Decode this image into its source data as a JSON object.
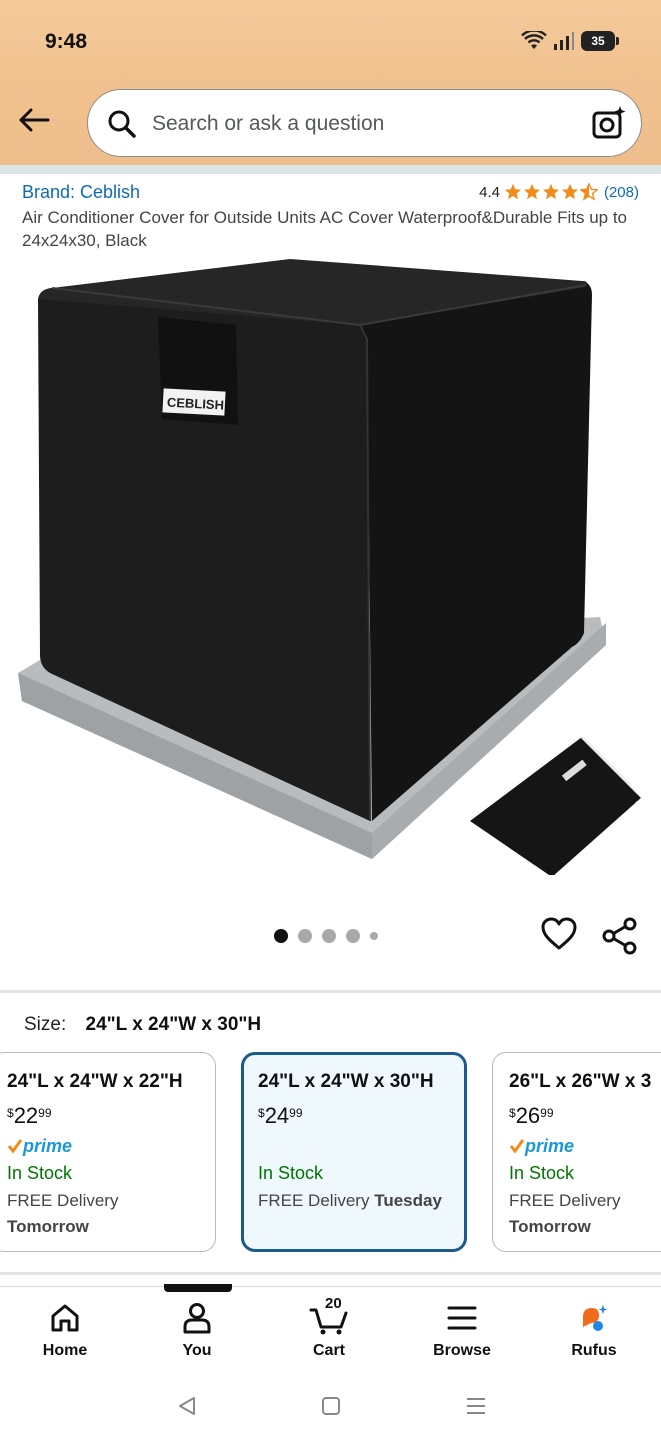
{
  "status_bar": {
    "time": "9:48",
    "battery": "35"
  },
  "search": {
    "placeholder": "Search or ask a question"
  },
  "product": {
    "brand": "Brand: Ceblish",
    "rating": "4.4",
    "stars": 4.4,
    "review_count": "(208)",
    "title": "Air Conditioner Cover for Outside Units AC Cover Waterproof&Durable Fits up to 24x24x30, Black",
    "logo_text": "CEBLISH",
    "image_count": 5,
    "active_image": 1
  },
  "size": {
    "label": "Size:",
    "selected": "24\"L x 24\"W x 30\"H",
    "options": [
      {
        "title": "24\"L x 24\"W x 22\"H",
        "currency": "$",
        "whole": "22",
        "cents": "99",
        "prime": "prime",
        "stock": "In Stock",
        "delivery": "FREE Delivery",
        "delivery_day": "Tomorrow"
      },
      {
        "title": "24\"L x 24\"W x 30\"H",
        "currency": "$",
        "whole": "24",
        "cents": "99",
        "prime": "",
        "stock": "In Stock",
        "delivery": "FREE Delivery",
        "delivery_day": "Tuesday"
      },
      {
        "title": "26\"L x 26\"W x 3",
        "currency": "$",
        "whole": "26",
        "cents": "99",
        "prime": "prime",
        "stock": "In Stock",
        "delivery": "FREE Delivery",
        "delivery_day": "Tomorrow"
      }
    ]
  },
  "nav": {
    "home": "Home",
    "you": "You",
    "cart": "Cart",
    "cart_count": "20",
    "browse": "Browse",
    "rufus": "Rufus"
  },
  "colors": {
    "link": "#0f6ab4",
    "star": "#f08b1c",
    "in_stock": "#007600",
    "selected_border": "#1a5a8c",
    "header": "#f0c18e"
  }
}
